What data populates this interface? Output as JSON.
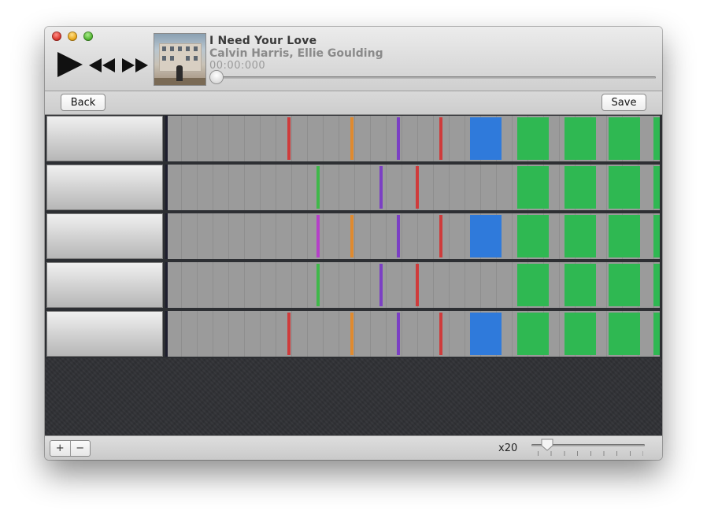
{
  "player": {
    "title": "I Need Your Love",
    "artist": "Calvin Harris, Ellie Goulding",
    "time": "00:00:000",
    "progress": 0
  },
  "toolbar": {
    "back_label": "Back",
    "save_label": "Save"
  },
  "bottom": {
    "add_label": "+",
    "remove_label": "−",
    "zoom_label": "x20",
    "zoom_level": 0.12
  },
  "colors": {
    "red": "#cf3b3b",
    "orange": "#e08a2e",
    "purple": "#7b3fc4",
    "green": "#3fb84a",
    "magenta": "#b53fc8",
    "blue": "#2f7adb",
    "block_green": "#2fb852"
  },
  "icons": {
    "play": "play-icon",
    "rewind": "rewind-icon",
    "fast_forward": "fast-forward-icon"
  }
}
